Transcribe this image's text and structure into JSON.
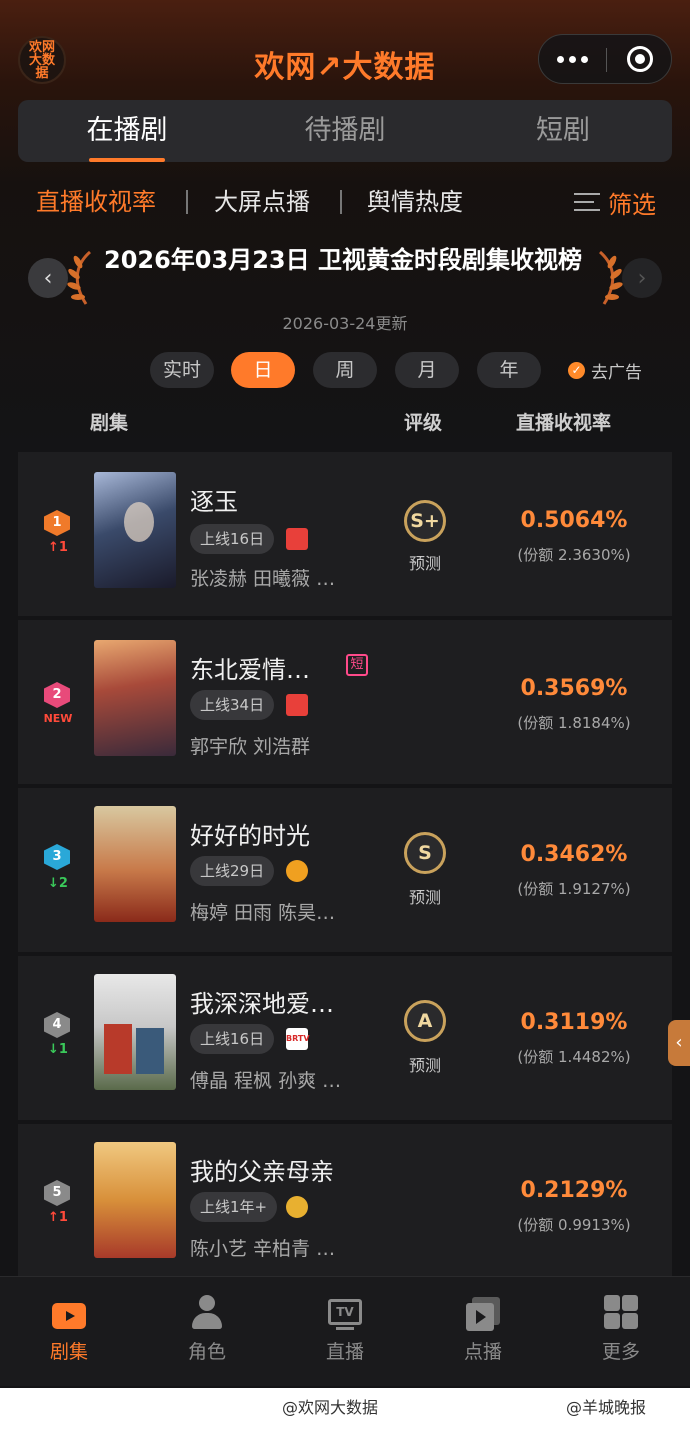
{
  "app": {
    "brand": "欢网↗大数据",
    "logo_text": "欢网大数据"
  },
  "main_tabs": [
    "在播剧",
    "待播剧",
    "短剧"
  ],
  "sub_tabs": [
    "直播收视率",
    "大屏点播",
    "舆情热度"
  ],
  "filter_label": "筛选",
  "rank_title": "2026年03月23日 卫视黄金时段剧集收视榜",
  "update_time": "2026-03-24更新",
  "periods": [
    "实时",
    "日",
    "周",
    "月",
    "年"
  ],
  "active_period": "日",
  "no_ad_label": "去广告",
  "columns": {
    "show": "剧集",
    "grade": "评级",
    "rating": "直播收视率"
  },
  "rows": [
    {
      "rank": "1",
      "trend": "↑1",
      "title": "逐玉",
      "days": "上线16日",
      "cast": "张凌赫 田曦薇 …",
      "grade": "S+",
      "predict": "预测",
      "rating": "0.5064%",
      "share": "(份额 2.3630%)",
      "rank_color": "#f07a2a",
      "trend_color": "#ff4a3a",
      "channel_color": "#e8403a"
    },
    {
      "rank": "2",
      "trend": "NEW",
      "title": "东北爱情…",
      "short_tag": "短",
      "days": "上线34日",
      "cast": "郭宇欣 刘浩群",
      "rating": "0.3569%",
      "share": "(份额 1.8184%)",
      "rank_color": "#e84a7a",
      "trend_color": "#ff4a3a",
      "channel_color": "#e8403a"
    },
    {
      "rank": "3",
      "trend": "↓2",
      "title": "好好的时光",
      "days": "上线29日",
      "cast": "梅婷 田雨 陈昊…",
      "grade": "S",
      "predict": "预测",
      "rating": "0.3462%",
      "share": "(份额 1.9127%)",
      "rank_color": "#2aa8d8",
      "trend_color": "#3ac85a",
      "channel_color": "#f0a020"
    },
    {
      "rank": "4",
      "trend": "↓1",
      "title": "我深深地爱…",
      "days": "上线16日",
      "cast": "傅晶 程枫 孙爽 …",
      "grade": "A",
      "predict": "预测",
      "rating": "0.3119%",
      "share": "(份额 1.4482%)",
      "rank_color": "#8a8a8a",
      "trend_color": "#3ac85a",
      "channel_color": "#d82a2a",
      "channel_text": "BRTV"
    },
    {
      "rank": "5",
      "trend": "↑1",
      "title": "我的父亲母亲",
      "days": "上线1年+",
      "cast": "陈小艺 辛柏青 …",
      "rating": "0.2129%",
      "share": "(份额 0.9913%)",
      "rank_color": "#8a8a8a",
      "trend_color": "#ff4a3a",
      "channel_color": "#e8b030"
    }
  ],
  "bottom_nav": [
    "剧集",
    "角色",
    "直播",
    "点播",
    "更多"
  ],
  "side_tab": "‹",
  "watermarks": [
    "@欢网大数据",
    "@羊城晚报"
  ]
}
